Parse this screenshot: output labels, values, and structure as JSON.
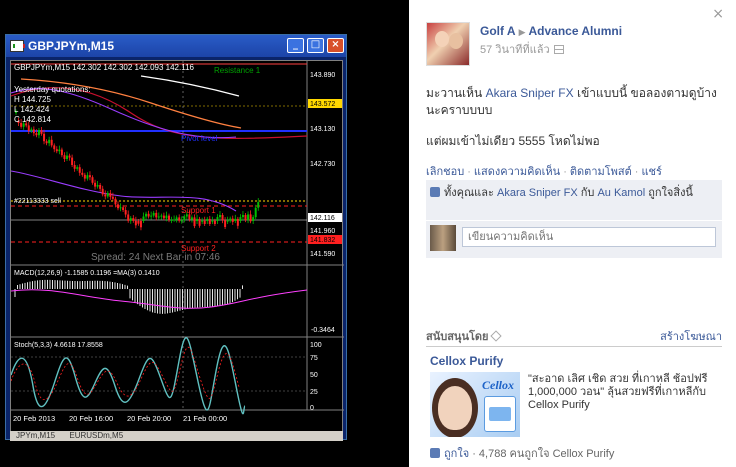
{
  "mt4": {
    "window_title": "GBPJPYm,M15",
    "header_line": "GBPJPYm,M15  142.302 142.302 142.093 142.116",
    "yesterday_label": "Yesterday quotations:",
    "yesterday_high": "H 144.725",
    "yesterday_low": "L 142.424",
    "yesterday_close": "C 142.814",
    "resistance_label": "Resistance 1",
    "pivot_label": "Pivot level",
    "support1_label": "Support 1",
    "support2_label": "Support 2",
    "order_label": "#22113333 sell",
    "spread_text": "Spread: 24  Next Bar in 07:46",
    "price_labels": [
      "143.890",
      "143.572",
      "143.130",
      "142.730",
      "142.116",
      "141.960",
      "141.832",
      "141.590"
    ],
    "macd_label": "MACD(12,26,9) -1.1585  0.1196  =MA(3) 0.1410",
    "macd_price_label": "-0.3464",
    "stoch_label": "Stoch(5,3,3) 4.6618 17.8558",
    "stoch_levels": [
      "100",
      "75",
      "50",
      "25",
      "0"
    ],
    "time_labels": [
      "20 Feb 2013",
      "20 Feb 16:00",
      "20 Feb 20:00",
      "21 Feb 00:00"
    ],
    "tabs": [
      "JPYm,M15",
      "EURUSDm,M5"
    ],
    "colors": {
      "bull_candle": "#00c000",
      "bear_candle": "#ff2020",
      "bollinger": "#9a3cff",
      "pivot": "#2030ff",
      "support": "#ff2020",
      "price_tag_yellow": "#ffd800",
      "price_tag_red": "#ff2020"
    }
  },
  "post": {
    "author": "Golf A",
    "target": "Advance Alumni",
    "time": "57 วินาทีที่แล้ว",
    "text_before_link": "มะวานเห็น ",
    "link_text": "Akara Sniper FX",
    "text_after_link": " เข้าแบบนี้ ขอลองตามดูบ้างนะคราบบบบ",
    "text_second": "แต่ผมเข้าไม่เดียว 5555 โหดไม่พอ",
    "actions": [
      "เลิกชอบ",
      "แสดงความคิดเห็น",
      "ติดตามโพสต์",
      "แชร์"
    ],
    "likes_prefix": "ทั้งคุณและ ",
    "likes_person1": "Akara Sniper FX",
    "likes_mid": " กับ ",
    "likes_person2": "Au Kamol",
    "likes_suffix": " ถูกใจสิ่งนี้",
    "comment_placeholder": "เขียนความคิดเห็น"
  },
  "sponsored": {
    "heading": "สนับสนุนโดย",
    "create_ad": "สร้างโฆษณา",
    "ad_title": "Cellox Purify",
    "ad_brand": "Cellox",
    "ad_text": "\"สะอาด เลิศ เชิด สวย ที่เกาหลี ช้อปฟรี 1,000,000 วอน\" ลุ้นสวยฟรีที่เกาหลีกับ Cellox Purify",
    "like_label": "ถูกใจ",
    "like_count": "4,788 คนถูกใจ Cellox Purify"
  }
}
